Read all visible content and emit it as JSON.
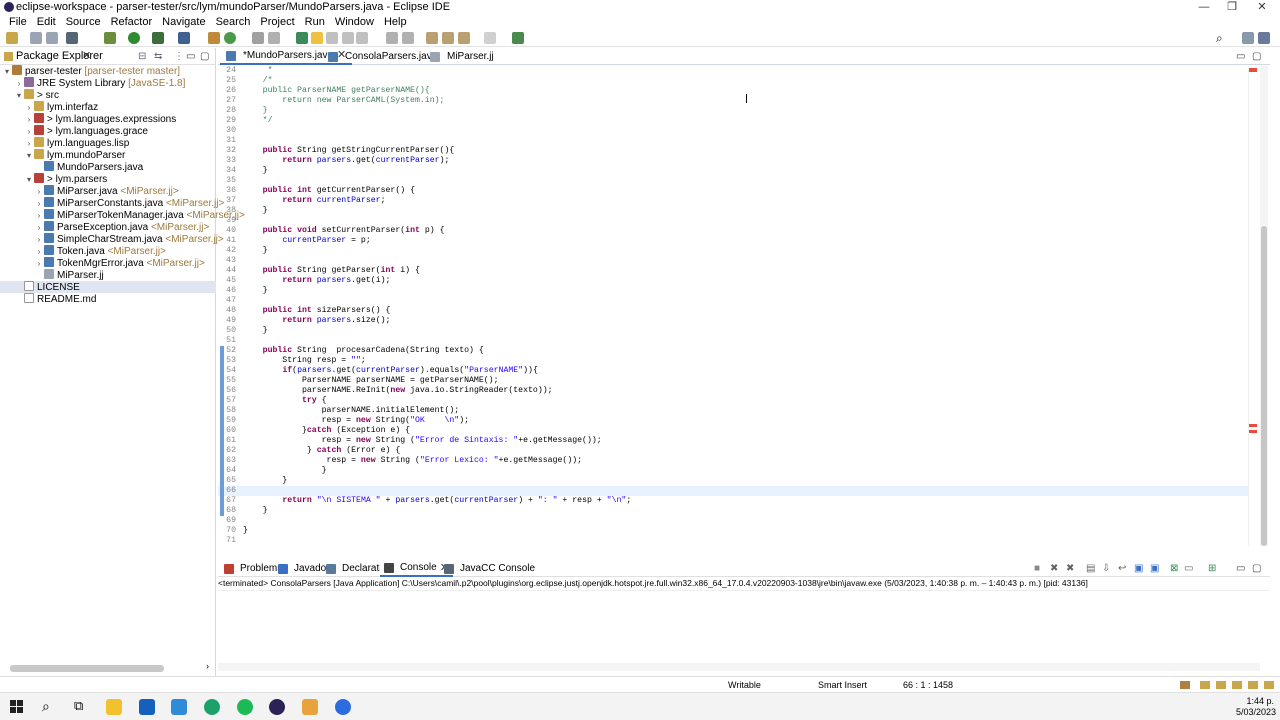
{
  "window": {
    "title": "eclipse-workspace - parser-tester/src/lym/mundoParser/MundoParsers.java - Eclipse IDE"
  },
  "menu": [
    "File",
    "Edit",
    "Source",
    "Refactor",
    "Navigate",
    "Search",
    "Project",
    "Run",
    "Window",
    "Help"
  ],
  "package_explorer": {
    "title": "Package Explorer",
    "items": [
      {
        "label": "parser-tester",
        "deco": "[parser-tester master]"
      },
      {
        "label": "JRE System Library",
        "deco": "[JavaSE-1.8]"
      },
      {
        "label": "> src",
        "deco": ""
      },
      {
        "label": "lym.interfaz",
        "deco": ""
      },
      {
        "label": "> lym.languages.expressions",
        "deco": ""
      },
      {
        "label": "> lym.languages.grace",
        "deco": ""
      },
      {
        "label": "lym.languages.lisp",
        "deco": ""
      },
      {
        "label": "lym.mundoParser",
        "deco": ""
      },
      {
        "label": "MundoParsers.java",
        "deco": ""
      },
      {
        "label": "> lym.parsers",
        "deco": ""
      },
      {
        "label": "MiParser.java",
        "deco": "<MiParser.jj>"
      },
      {
        "label": "MiParserConstants.java",
        "deco": "<MiParser.jj>"
      },
      {
        "label": "MiParserTokenManager.java",
        "deco": "<MiParser.jj>"
      },
      {
        "label": "ParseException.java",
        "deco": "<MiParser.jj>"
      },
      {
        "label": "SimpleCharStream.java",
        "deco": "<MiParser.jj>"
      },
      {
        "label": "Token.java",
        "deco": "<MiParser.jj>"
      },
      {
        "label": "TokenMgrError.java",
        "deco": "<MiParser.jj>"
      },
      {
        "label": "MiParser.jj",
        "deco": ""
      },
      {
        "label": "LICENSE",
        "deco": ""
      },
      {
        "label": "README.md",
        "deco": ""
      }
    ]
  },
  "editor_tabs": [
    "*MundoParsers.java",
    "ConsolaParsers.java",
    "MiParser.jj"
  ],
  "code": [
    {
      "n": "24",
      "t": "     *"
    },
    {
      "n": "25",
      "t": "    /*"
    },
    {
      "n": "26",
      "t": "    public ParserNAME getParserNAME(){"
    },
    {
      "n": "27",
      "t": "        return new ParserCAML(System.in);"
    },
    {
      "n": "28",
      "t": "    }"
    },
    {
      "n": "29",
      "t": "    */"
    },
    {
      "n": "30",
      "t": ""
    },
    {
      "n": "31",
      "t": ""
    },
    {
      "n": "32",
      "t": "    public String getStringCurrentParser(){"
    },
    {
      "n": "33",
      "t": "        return parsers.get(currentParser);"
    },
    {
      "n": "34",
      "t": "    }"
    },
    {
      "n": "35",
      "t": ""
    },
    {
      "n": "36",
      "t": "    public int getCurrentParser() {"
    },
    {
      "n": "37",
      "t": "        return currentParser;"
    },
    {
      "n": "38",
      "t": "    }"
    },
    {
      "n": "39",
      "t": ""
    },
    {
      "n": "40",
      "t": "    public void setCurrentParser(int p) {"
    },
    {
      "n": "41",
      "t": "        currentParser = p;"
    },
    {
      "n": "42",
      "t": "    }"
    },
    {
      "n": "43",
      "t": ""
    },
    {
      "n": "44",
      "t": "    public String getParser(int i) {"
    },
    {
      "n": "45",
      "t": "        return parsers.get(i);"
    },
    {
      "n": "46",
      "t": "    }"
    },
    {
      "n": "47",
      "t": ""
    },
    {
      "n": "48",
      "t": "    public int sizeParsers() {"
    },
    {
      "n": "49",
      "t": "        return parsers.size();"
    },
    {
      "n": "50",
      "t": "    }"
    },
    {
      "n": "51",
      "t": ""
    },
    {
      "n": "52",
      "t": "    public String  procesarCadena(String texto) {"
    },
    {
      "n": "53",
      "t": "        String resp = \"\";"
    },
    {
      "n": "54",
      "t": "        if(parsers.get(currentParser).equals(\"ParserNAME\")){"
    },
    {
      "n": "55",
      "t": "            ParserNAME parserNAME = getParserNAME();"
    },
    {
      "n": "56",
      "t": "            parserNAME.ReInit(new java.io.StringReader(texto));"
    },
    {
      "n": "57",
      "t": "            try {"
    },
    {
      "n": "58",
      "t": "                parserNAME.initialElement();"
    },
    {
      "n": "59",
      "t": "                resp = new String(\"OK    \\n\");"
    },
    {
      "n": "60",
      "t": "            }catch (Exception e) {"
    },
    {
      "n": "61",
      "t": "                resp = new String (\"Error de Sintaxis: \"+e.getMessage());"
    },
    {
      "n": "62",
      "t": "             } catch (Error e) {"
    },
    {
      "n": "63",
      "t": "                 resp = new String (\"Error Lexico: \"+e.getMessage());"
    },
    {
      "n": "64",
      "t": "                }"
    },
    {
      "n": "65",
      "t": "        }"
    },
    {
      "n": "66",
      "t": ""
    },
    {
      "n": "67",
      "t": "        return \"\\n SISTEMA \" + parsers.get(currentParser) + \": \" + resp + \"\\n\";"
    },
    {
      "n": "68",
      "t": "    }"
    },
    {
      "n": "69",
      "t": ""
    },
    {
      "n": "70",
      "t": "}"
    },
    {
      "n": "71",
      "t": ""
    }
  ],
  "console_tabs": [
    "Problems",
    "Javadoc",
    "Declaration",
    "Console",
    "JavaCC Console"
  ],
  "console_status": "<terminated> ConsolaParsers [Java Application] C:\\Users\\camil\\.p2\\pool\\plugins\\org.eclipse.justj.openjdk.hotspot.jre.full.win32.x86_64_17.0.4.v20220903-1038\\jre\\bin\\javaw.exe  (5/03/2023, 1:40:38 p. m. – 1:40:43 p. m.) [pid: 43136]",
  "status": {
    "mode": "Writable",
    "insert": "Smart Insert",
    "position": "66 : 1 : 1458"
  },
  "clock": {
    "time": "1:44 p.",
    "date": "5/03/2023"
  }
}
